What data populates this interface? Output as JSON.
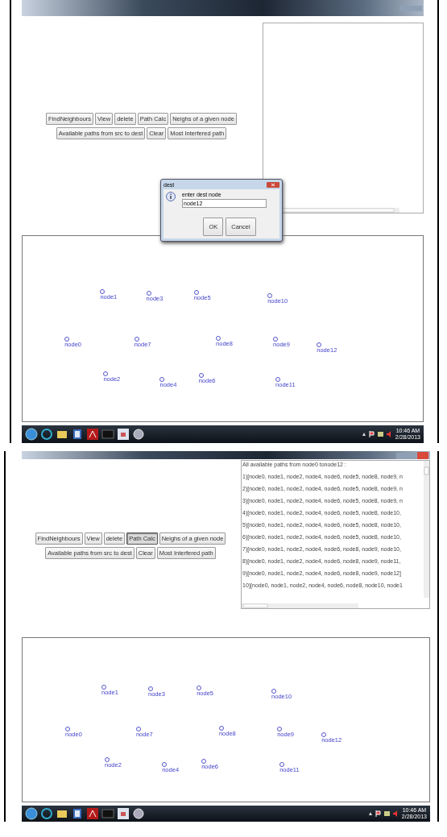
{
  "screens": [
    {
      "toolbar_buttons": [
        {
          "label": "FindNeighbours",
          "selected": false
        },
        {
          "label": "View",
          "selected": false
        },
        {
          "label": "delete",
          "selected": false
        },
        {
          "label": "Path Calc",
          "selected": false
        },
        {
          "label": "Neighs of a given node",
          "selected": false
        },
        {
          "label": "Available paths from src to dest",
          "selected": false
        },
        {
          "label": "Clear",
          "selected": false
        },
        {
          "label": "Most Interfered path",
          "selected": false
        }
      ],
      "graph_nodes": [
        "node1",
        "node3",
        "node5",
        "node10",
        "node0",
        "node7",
        "node8",
        "node9",
        "node12",
        "node2",
        "node4",
        "node6",
        "node11"
      ],
      "dialog": {
        "title": "dest",
        "message": "enter dest node",
        "value": "node12",
        "buttons": [
          "OK",
          "Cancel"
        ]
      },
      "taskbar": {
        "time": "10:46 AM",
        "date": "2/28/2013"
      }
    },
    {
      "toolbar_buttons": [
        {
          "label": "FindNeighbours",
          "selected": false
        },
        {
          "label": "View",
          "selected": false
        },
        {
          "label": "delete",
          "selected": false
        },
        {
          "label": "Path Calc",
          "selected": true
        },
        {
          "label": "Neighs of a given node",
          "selected": false
        },
        {
          "label": "Available paths from src to dest",
          "selected": false
        },
        {
          "label": "Clear",
          "selected": false
        },
        {
          "label": "Most Interfered path",
          "selected": false
        }
      ],
      "output_lines": [
        "All available paths from node0 tonode12 :",
        "1)[node0, node1, node2, node4, node6, node5, node8, node9, n",
        "2)[node0, node1, node2, node4, node6, node5, node8, node9, n",
        "3)[node0, node1, node2, node4, node6, node5, node8, node9, n",
        "4)[node0, node1, node2, node4, node6, node5, node8, node10,",
        "5)[node0, node1, node2, node4, node6, node5, node8, node10,",
        "6)[node0, node1, node2, node4, node6, node5, node8, node10,",
        "7)[node0, node1, node2, node4, node6, node8, node9, node10,",
        "8)[node0, node1, node2, node4, node6, node8, node9, node11,",
        "9)[node0, node1, node2, node4, node6, node8, node9, node12]",
        "10)[node0, node1, node2, node4, node6, node8, node10, node1"
      ],
      "graph_nodes": [
        "node1",
        "node3",
        "node5",
        "node10",
        "node0",
        "node7",
        "node8",
        "node9",
        "node12",
        "node2",
        "node4",
        "node6",
        "node11"
      ],
      "taskbar": {
        "time": "10:46 AM",
        "date": "2/28/2013"
      }
    }
  ]
}
